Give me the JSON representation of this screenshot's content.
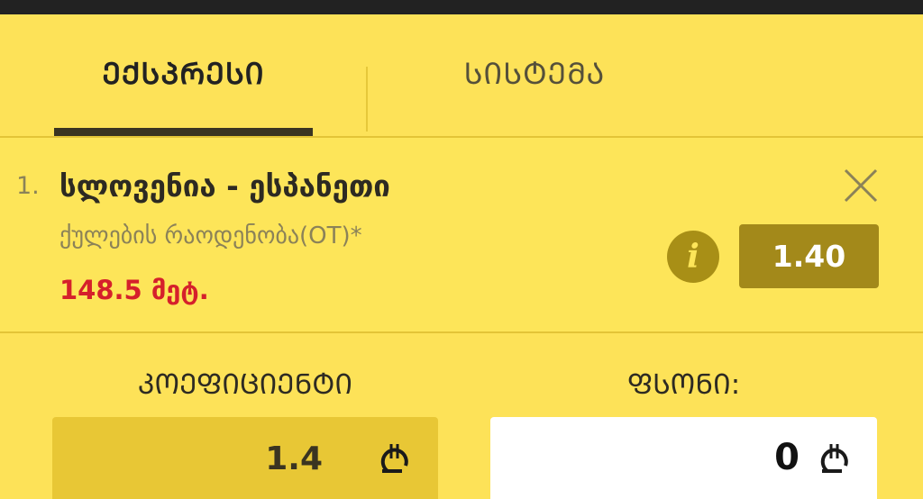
{
  "tabs": {
    "express": "ᲔᲥᲡᲞᲠᲔᲡᲘ",
    "system": "ᲡᲘᲡᲢᲔᲛᲐ",
    "active": "express"
  },
  "bet": {
    "number": "1.",
    "match": "სლოვენია - ესპანეთი",
    "market": "ქულების რაოდენობა(OT)*",
    "selection": "148.5 მეტ.",
    "odds": "1.40",
    "info_icon": "info-icon",
    "close_icon": "close-icon"
  },
  "coefficient": {
    "label": "ᲙᲝᲔᲤᲘᲪᲘᲔᲜᲢᲘ",
    "value": "1.4",
    "currency_icon": "lari-icon"
  },
  "stake": {
    "label": "ᲤᲡᲝᲜᲘ:",
    "value": "0",
    "currency_icon": "lari-icon"
  },
  "colors": {
    "background": "#fde258",
    "odds_button": "#a3891a",
    "selection_text": "#d5202b",
    "topbar": "#222222"
  }
}
